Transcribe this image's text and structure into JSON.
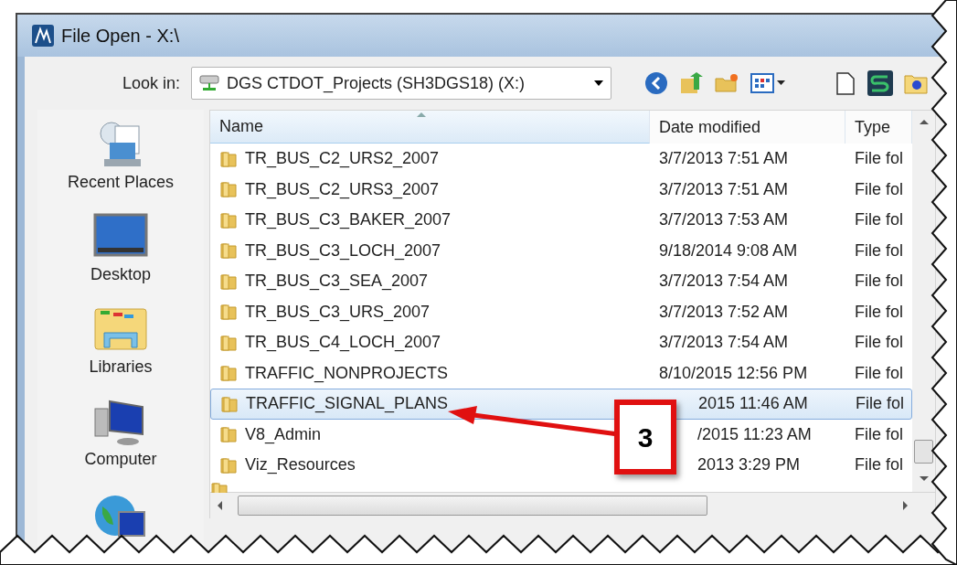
{
  "window": {
    "title": "File Open - X:\\"
  },
  "look_in": {
    "label": "Look in:",
    "value": "DGS CTDOT_Projects (SH3DGS18) (X:)"
  },
  "sidebar": {
    "items": [
      {
        "label": "Recent Places",
        "kind": "recent"
      },
      {
        "label": "Desktop",
        "kind": "desktop"
      },
      {
        "label": "Libraries",
        "kind": "libraries"
      },
      {
        "label": "Computer",
        "kind": "computer"
      },
      {
        "kind": "network"
      }
    ]
  },
  "table": {
    "columns": [
      {
        "label": "Name",
        "sorted": true
      },
      {
        "label": "Date modified",
        "sorted": false
      },
      {
        "label": "Type",
        "sorted": false
      }
    ],
    "rows": [
      {
        "name": "TR_BUS_C2_URS2_2007",
        "date": "3/7/2013 7:51 AM",
        "type": "File fol",
        "selected": false
      },
      {
        "name": "TR_BUS_C2_URS3_2007",
        "date": "3/7/2013 7:51 AM",
        "type": "File fol",
        "selected": false
      },
      {
        "name": "TR_BUS_C3_BAKER_2007",
        "date": "3/7/2013 7:53 AM",
        "type": "File fol",
        "selected": false
      },
      {
        "name": "TR_BUS_C3_LOCH_2007",
        "date": "9/18/2014 9:08 AM",
        "type": "File fol",
        "selected": false
      },
      {
        "name": "TR_BUS_C3_SEA_2007",
        "date": "3/7/2013 7:54 AM",
        "type": "File fol",
        "selected": false
      },
      {
        "name": "TR_BUS_C3_URS_2007",
        "date": "3/7/2013 7:52 AM",
        "type": "File fol",
        "selected": false
      },
      {
        "name": "TR_BUS_C4_LOCH_2007",
        "date": "3/7/2013 7:54 AM",
        "type": "File fol",
        "selected": false
      },
      {
        "name": "TRAFFIC_NONPROJECTS",
        "date": "8/10/2015 12:56 PM",
        "type": "File fol",
        "selected": false
      },
      {
        "name": "TRAFFIC_SIGNAL_PLANS",
        "date": "2015 11:46 AM",
        "type": "File fol",
        "selected": true,
        "covered": true
      },
      {
        "name": "V8_Admin",
        "date": "/2015 11:23 AM",
        "type": "File fol",
        "selected": false,
        "covered": true
      },
      {
        "name": "Viz_Resources",
        "date": "2013 3:29 PM",
        "type": "File fol",
        "selected": false,
        "covered": true
      }
    ]
  },
  "callout": {
    "label": "3"
  }
}
